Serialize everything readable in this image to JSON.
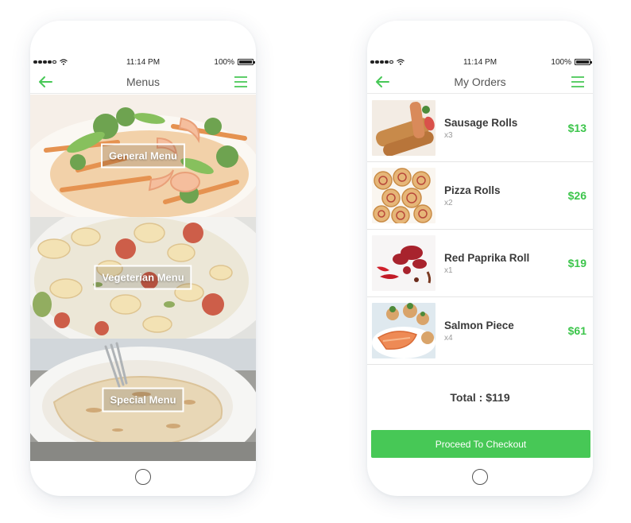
{
  "theme": {
    "accent": "#47c856",
    "price_color": "#3cc54b",
    "text_dark": "#3a3a3a"
  },
  "left_phone": {
    "status": {
      "time": "11:14 PM",
      "battery": "100%"
    },
    "nav": {
      "title": "Menus",
      "back_icon": "back-arrow-icon",
      "menu_icon": "hamburger-menu-icon"
    },
    "tiles": [
      {
        "label": "General Menu",
        "image": "shrimp-vegetable-dish"
      },
      {
        "label": "Vegeterian Menu",
        "image": "gnocchi-tomato-dish"
      },
      {
        "label": "Special Menu",
        "image": "crepe-plate-with-fork"
      }
    ]
  },
  "right_phone": {
    "status": {
      "time": "11:14 PM",
      "battery": "100%"
    },
    "nav": {
      "title": "My Orders",
      "back_icon": "back-arrow-icon",
      "menu_icon": "hamburger-menu-icon"
    },
    "orders": [
      {
        "name": "Sausage Rolls",
        "qty": "x3",
        "price": "$13"
      },
      {
        "name": "Pizza Rolls",
        "qty": "x2",
        "price": "$26"
      },
      {
        "name": "Red Paprika Roll",
        "qty": "x1",
        "price": "$19"
      },
      {
        "name": "Salmon Piece",
        "qty": "x4",
        "price": "$61"
      }
    ],
    "total": "Total : $119",
    "checkout_label": "Proceed To Checkout"
  }
}
